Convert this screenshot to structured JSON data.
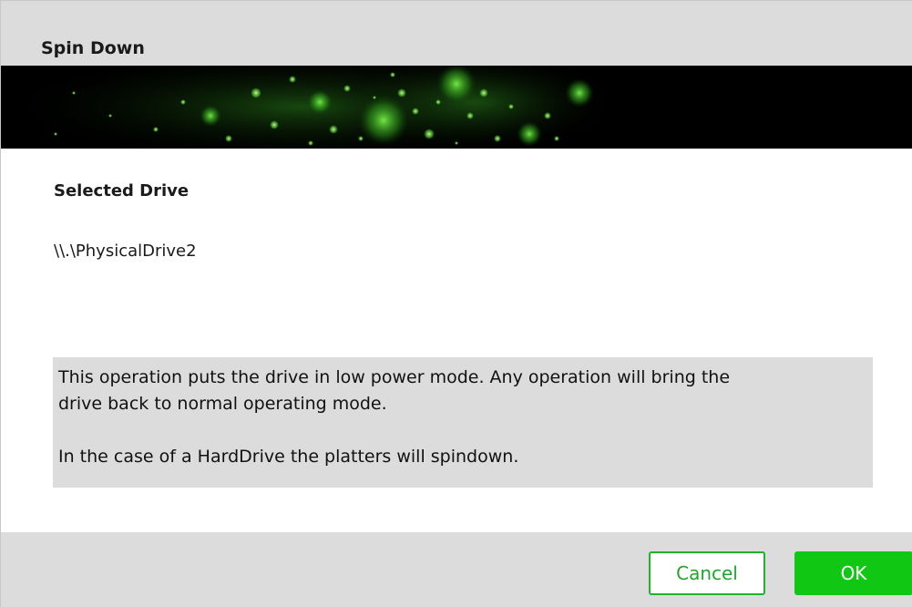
{
  "dialog": {
    "title": "Spin Down",
    "accent_color": "#10c814"
  },
  "drive": {
    "section_label": "Selected Drive",
    "path": "\\\\.\\PhysicalDrive2"
  },
  "info": {
    "line1": "This operation puts the drive in low power mode. Any operation will bring the",
    "line2": "drive back to normal operating mode.",
    "line3": "In the case of a HardDrive the platters will spindown."
  },
  "buttons": {
    "cancel_label": "Cancel",
    "ok_label": "OK"
  }
}
